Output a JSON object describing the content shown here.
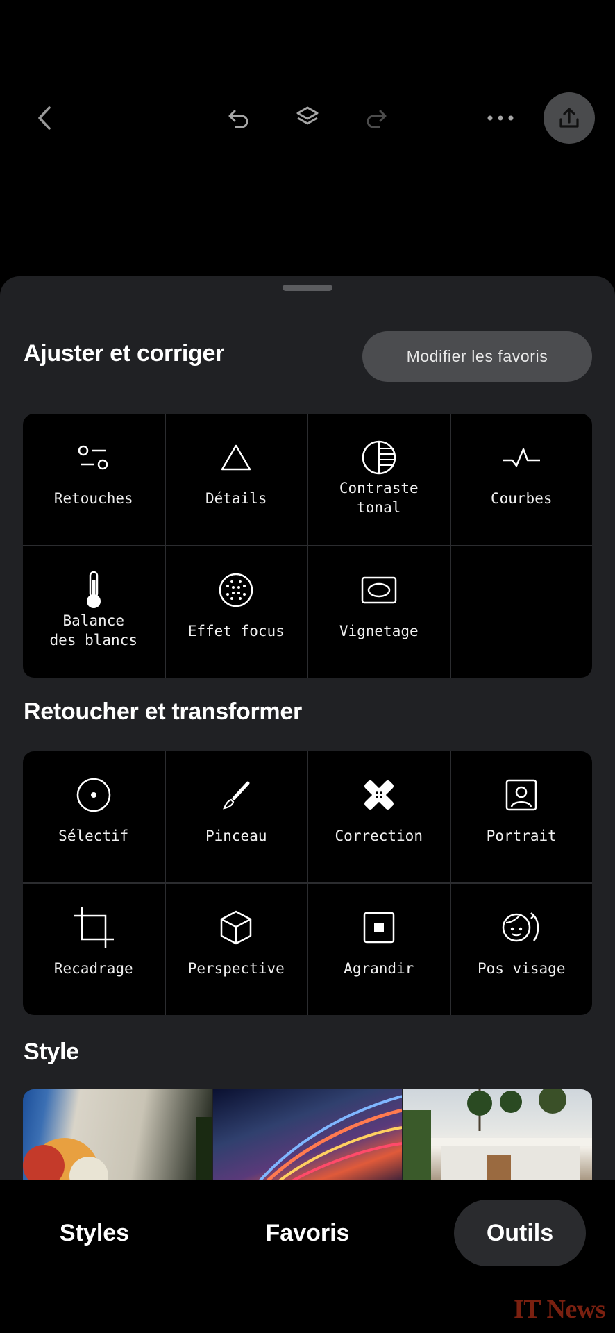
{
  "toolbar": {
    "back_icon": "chevron-left-icon",
    "undo_icon": "undo-icon",
    "layers_icon": "layers-icon",
    "redo_icon": "redo-icon",
    "more_icon": "more-horizontal-icon",
    "export_icon": "share-upload-icon"
  },
  "sections": {
    "adjust": {
      "title": "Ajuster et corriger",
      "edit_favorites_label": "Modifier les favoris",
      "tools": [
        {
          "label": "Retouches",
          "icon": "sliders-icon"
        },
        {
          "label": "Détails",
          "icon": "triangle-icon"
        },
        {
          "label": "Contraste\ntonal",
          "icon": "tonal-contrast-icon"
        },
        {
          "label": "Courbes",
          "icon": "curves-icon"
        },
        {
          "label": "Balance\ndes blancs",
          "icon": "thermometer-icon"
        },
        {
          "label": "Effet focus",
          "icon": "focus-dots-icon"
        },
        {
          "label": "Vignetage",
          "icon": "vignette-icon"
        }
      ]
    },
    "retouch": {
      "title": "Retoucher et transformer",
      "tools": [
        {
          "label": "Sélectif",
          "icon": "target-icon"
        },
        {
          "label": "Pinceau",
          "icon": "brush-icon"
        },
        {
          "label": "Correction",
          "icon": "bandage-icon"
        },
        {
          "label": "Portrait",
          "icon": "portrait-icon"
        },
        {
          "label": "Recadrage",
          "icon": "crop-icon"
        },
        {
          "label": "Perspective",
          "icon": "cube-icon"
        },
        {
          "label": "Agrandir",
          "icon": "expand-square-icon"
        },
        {
          "label": "Pos visage",
          "icon": "face-rotate-icon"
        }
      ]
    },
    "style": {
      "title": "Style"
    }
  },
  "nav": {
    "styles": "Styles",
    "favoris": "Favoris",
    "outils": "Outils",
    "active": "Outils"
  },
  "watermark": "IT News",
  "colors": {
    "background": "#000000",
    "sheet": "#202124",
    "accent_button": "#4b4c4f"
  }
}
